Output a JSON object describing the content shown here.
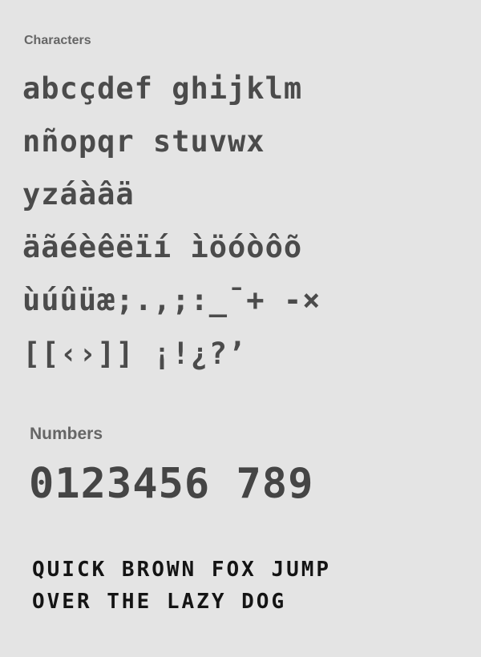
{
  "characters_label": "Characters",
  "characters_rows": [
    "abcçdef ghijklm",
    "nñopqr stuvwx",
    "yzáàâä",
    "äãéèêëïí ìöóòôõ",
    "ùúûüæ;.,;:_¯+ -×",
    "[[‹›]] ¡!¿?’"
  ],
  "numbers_label": "Numbers",
  "numbers_text": "0123456 789",
  "sample_lines": [
    "QUICK BROWN FOX JUMP",
    "OVER THE LAZY DOG"
  ]
}
